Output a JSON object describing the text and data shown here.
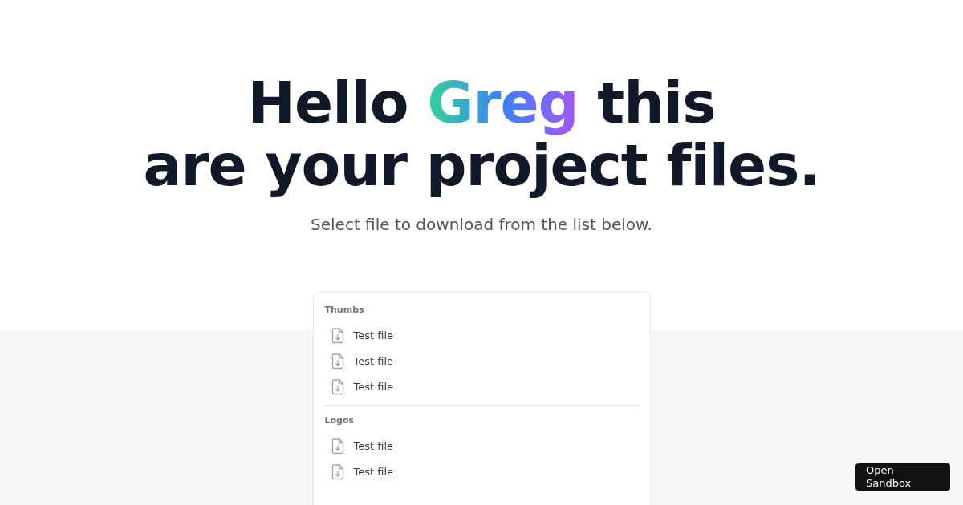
{
  "heading": {
    "before": "Hello ",
    "highlight": "Greg",
    "after": " this",
    "line_2": "are your project files."
  },
  "subtitle": "Select file to download from the list below.",
  "groups": [
    {
      "title": "Thumbs",
      "files": [
        "Test file",
        "Test file",
        "Test file"
      ]
    },
    {
      "title": "Logos",
      "files": [
        "Test file",
        "Test file"
      ]
    }
  ],
  "sandbox_button": "Open Sandbox"
}
